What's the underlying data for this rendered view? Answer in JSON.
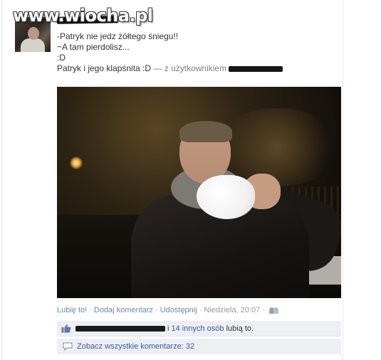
{
  "watermark": "www.wiocha.pl",
  "post": {
    "lines": [
      "-Patryk nie jedz żółtego śniegu!!",
      "~A tam pierdolisz...",
      ":D"
    ],
    "caption": "Patryk i jego klapśnita :D",
    "with_text": "— z użytkownikiem"
  },
  "actions": {
    "like": "Lubię to!",
    "comment": "Dodaj komentarz",
    "share": "Udostępnij",
    "timestamp": "Niedziela, 20:07",
    "separator": "·"
  },
  "likes": {
    "suffix": "i",
    "others_link": "14 innych osób",
    "tail": "lubią to."
  },
  "comments": {
    "view_all": "Zobacz wszystkie komentarze: 32"
  },
  "colors": {
    "link": "#3b5998",
    "action_link": "#6d84b4",
    "meta_grey": "#9a9a9a",
    "box_bg": "#edeff4"
  },
  "icons": {
    "audience": "people-icon",
    "like": "thumbs-up-icon",
    "comments": "speech-bubble-icon"
  }
}
